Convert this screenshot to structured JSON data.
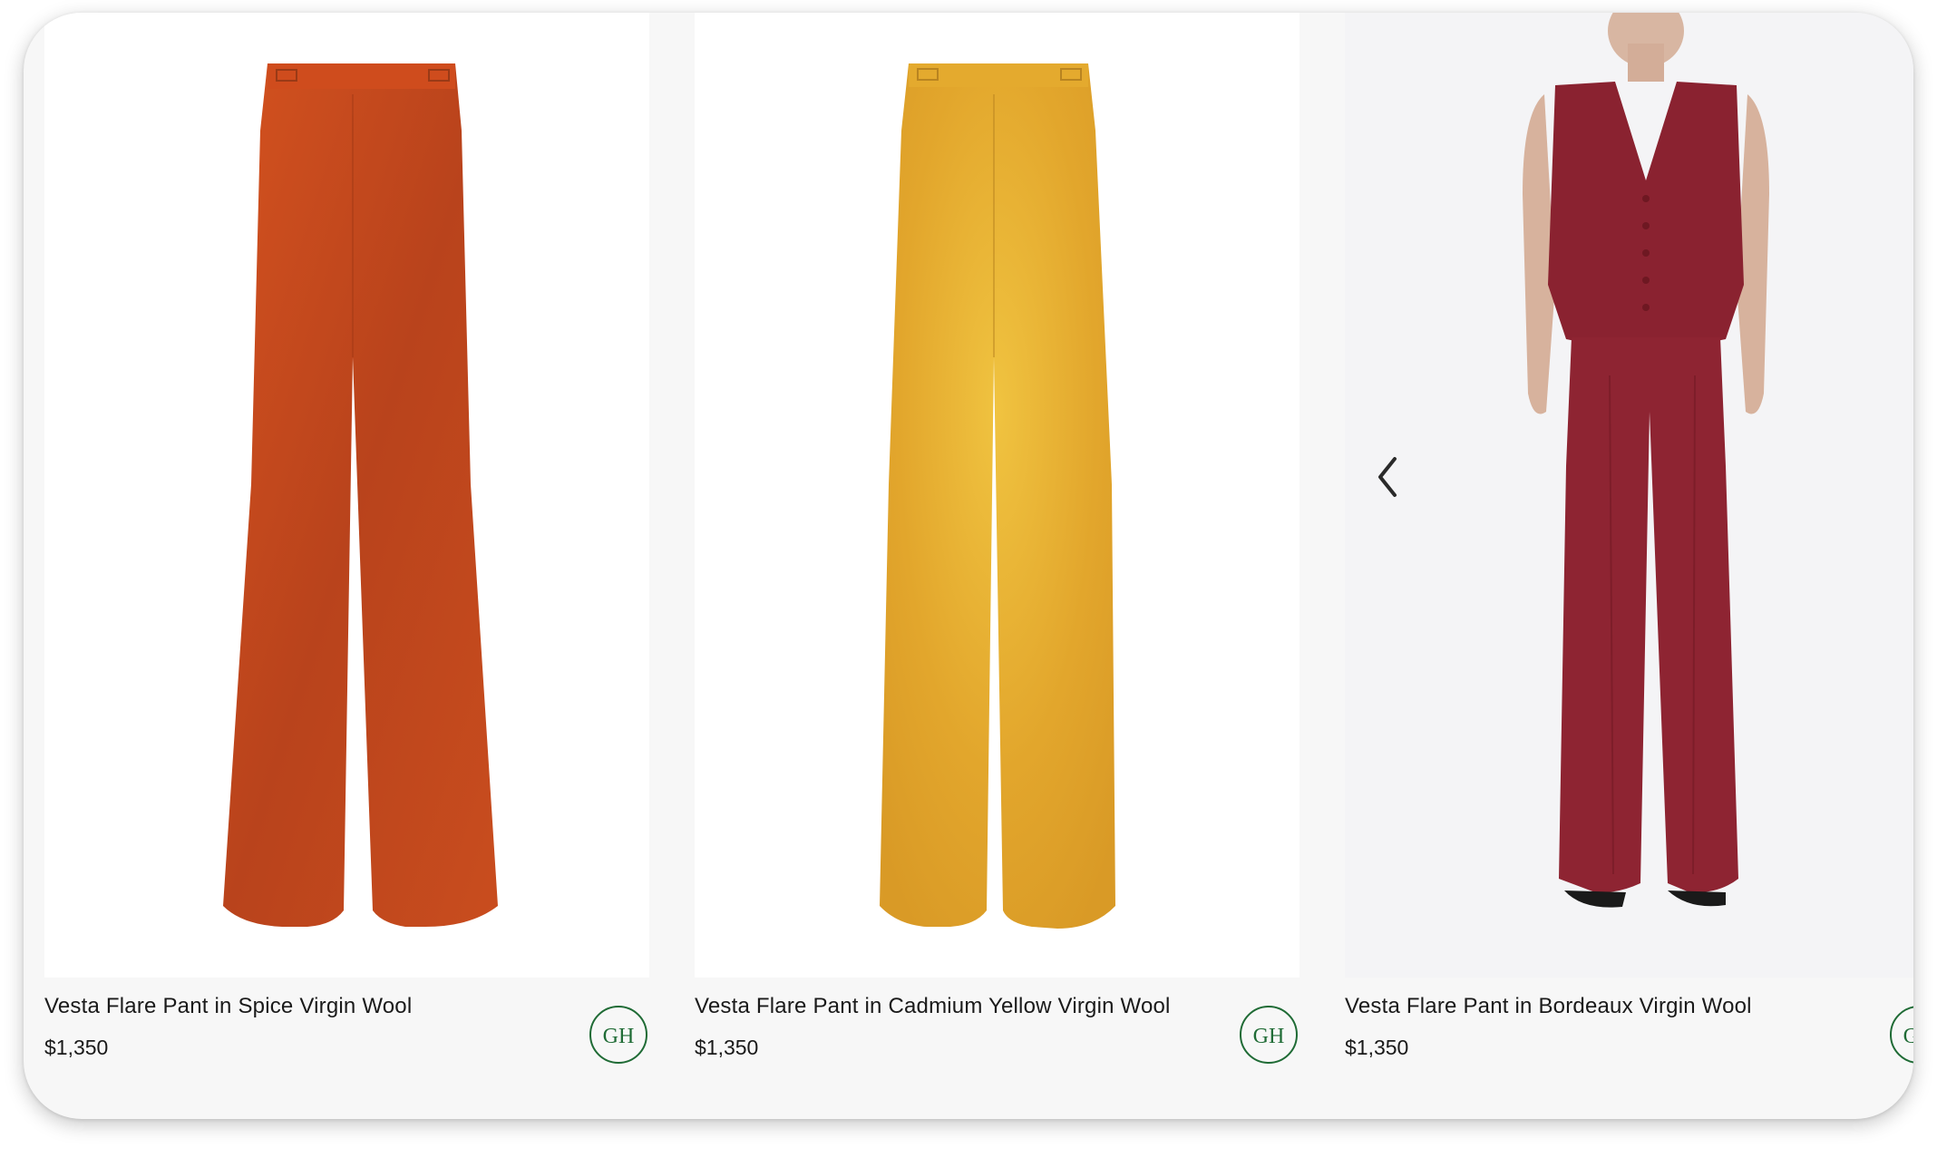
{
  "products": [
    {
      "title": "Vesta Flare Pant in Spice Virgin Wool",
      "price": "$1,350",
      "image": "spice-pant-flat",
      "badge": "GH"
    },
    {
      "title": "Vesta Flare Pant in Cadmium Yellow Virgin Wool",
      "price": "$1,350",
      "image": "yellow-pant-flat",
      "badge": "GH"
    },
    {
      "title": "Vesta Flare Pant in Bordeaux Virgin Wool",
      "price": "$1,350",
      "image": "bordeaux-model-look",
      "badge": "GH"
    }
  ],
  "carousel": {
    "prev_icon": "chevron-left-icon",
    "next_icon": "chevron-right-icon"
  },
  "colors": {
    "spice": "#c8481c",
    "yellow": "#e0a42a",
    "bordeaux": "#8e2432",
    "badge": "#1f6b35"
  }
}
